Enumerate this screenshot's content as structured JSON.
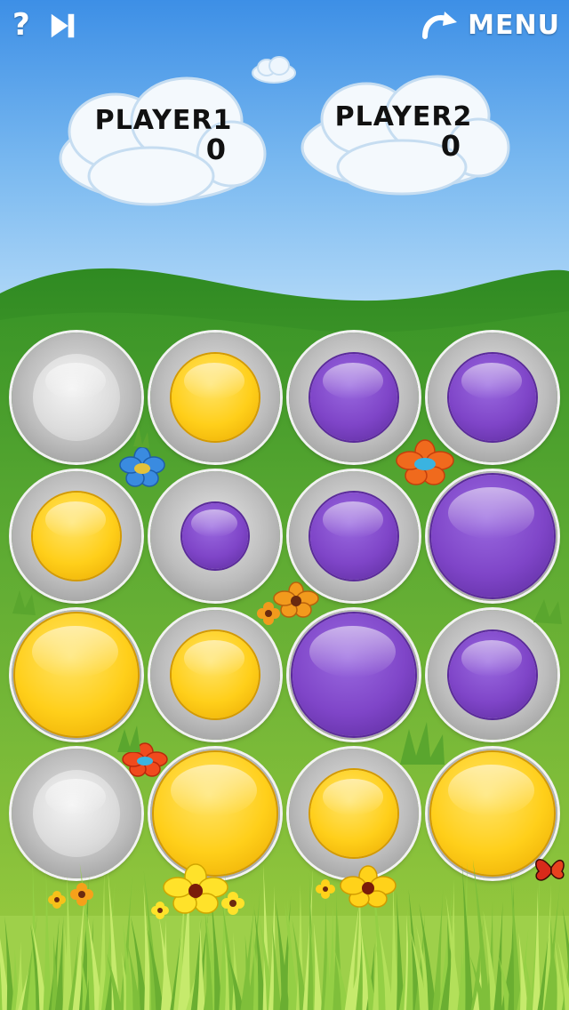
{
  "topbar": {
    "help_icon": "question-icon",
    "skip_icon": "skip-forward-icon",
    "menu_label": "MENU",
    "menu_icon": "undo-arrow-icon"
  },
  "players": [
    {
      "name": "PLAYER1",
      "score": "0"
    },
    {
      "name": "PLAYER2",
      "score": "0"
    }
  ],
  "colors": {
    "yellow": "#ffcf1a",
    "purple": "#7f45c8",
    "empty": "#d9d9d9",
    "grass": "#6ab536"
  },
  "board": [
    [
      {
        "color": "empty",
        "size": "medium"
      },
      {
        "color": "yellow",
        "size": "medium"
      },
      {
        "color": "purple",
        "size": "medium"
      },
      {
        "color": "purple",
        "size": "medium"
      }
    ],
    [
      {
        "color": "yellow",
        "size": "medium"
      },
      {
        "color": "purple",
        "size": "small"
      },
      {
        "color": "purple",
        "size": "medium"
      },
      {
        "color": "purple",
        "size": "large"
      }
    ],
    [
      {
        "color": "yellow",
        "size": "large"
      },
      {
        "color": "yellow",
        "size": "medium"
      },
      {
        "color": "purple",
        "size": "large"
      },
      {
        "color": "purple",
        "size": "medium"
      }
    ],
    [
      {
        "color": "empty",
        "size": "medium"
      },
      {
        "color": "yellow",
        "size": "large"
      },
      {
        "color": "yellow",
        "size": "medium"
      },
      {
        "color": "yellow",
        "size": "large"
      }
    ]
  ]
}
